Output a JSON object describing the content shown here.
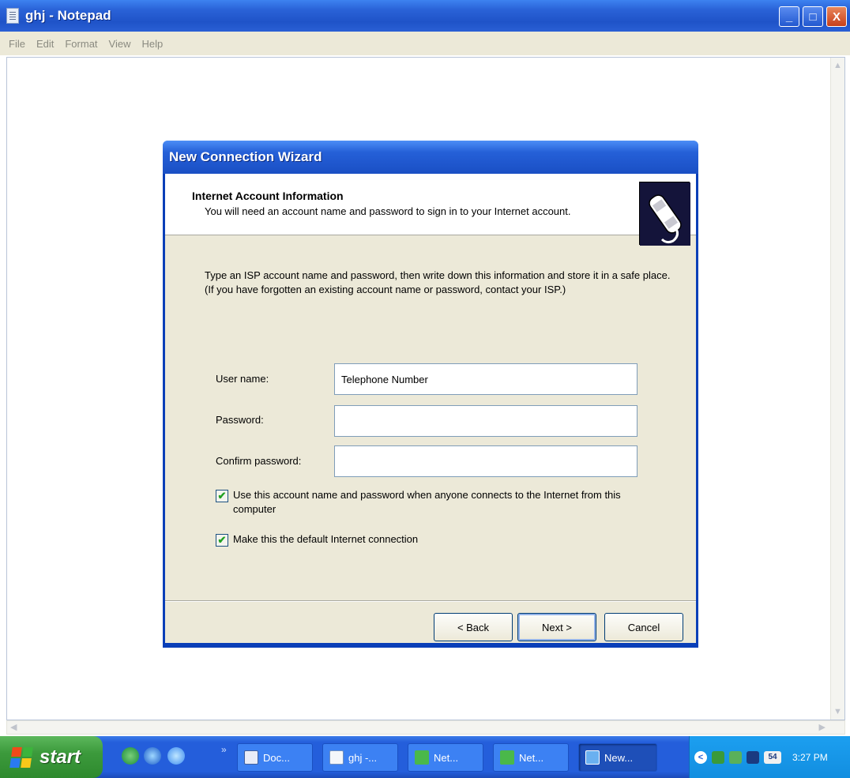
{
  "notepad": {
    "title": "ghj - Notepad",
    "menu": [
      "File",
      "Edit",
      "Format",
      "View",
      "Help"
    ],
    "window_buttons": {
      "minimize": "_",
      "maximize": "□",
      "close": "X"
    }
  },
  "wizard": {
    "title": "New Connection Wizard",
    "heading": "Internet Account Information",
    "subheading": "You will need an account name and password to sign in to your Internet account.",
    "instructions": "Type an ISP account name and password, then write down this information and store it in a safe place. (If you have forgotten an existing account name or password, contact your ISP.)",
    "fields": {
      "user_name": {
        "label": "User name:",
        "value": "Telephone Number"
      },
      "password": {
        "label": "Password:",
        "value": ""
      },
      "confirm_password": {
        "label": "Confirm password:",
        "value": ""
      }
    },
    "checkboxes": {
      "use_account": {
        "label": "Use this account  name and password when anyone connects to the Internet from this computer",
        "checked": true
      },
      "default_connection": {
        "label": "Make this the default Internet connection",
        "checked": true
      }
    },
    "buttons": {
      "back": "< Back",
      "next": "Next >",
      "cancel": "Cancel"
    },
    "header_icon": "phone-handset-icon"
  },
  "taskbar": {
    "start_label": "start",
    "quick_launch": [
      "network-icon",
      "internet-explorer-icon",
      "ie-alt-icon"
    ],
    "overflow": "»",
    "tasks": [
      {
        "label": "Doc...",
        "icon": "word-document-icon"
      },
      {
        "label": "ghj -...",
        "icon": "notepad-icon"
      },
      {
        "label": "Net...",
        "icon": "network-connection-icon"
      },
      {
        "label": "Net...",
        "icon": "network-connection-icon"
      },
      {
        "label": "New...",
        "icon": "wizard-icon"
      }
    ],
    "tray": {
      "chevron": "<",
      "badge": "54",
      "time": "3:27 PM"
    }
  },
  "colors": {
    "xp_blue": "#245edb",
    "start_green": "#3c9a3c",
    "dialog_bg": "#ece9d8",
    "check_green": "#21a121"
  }
}
